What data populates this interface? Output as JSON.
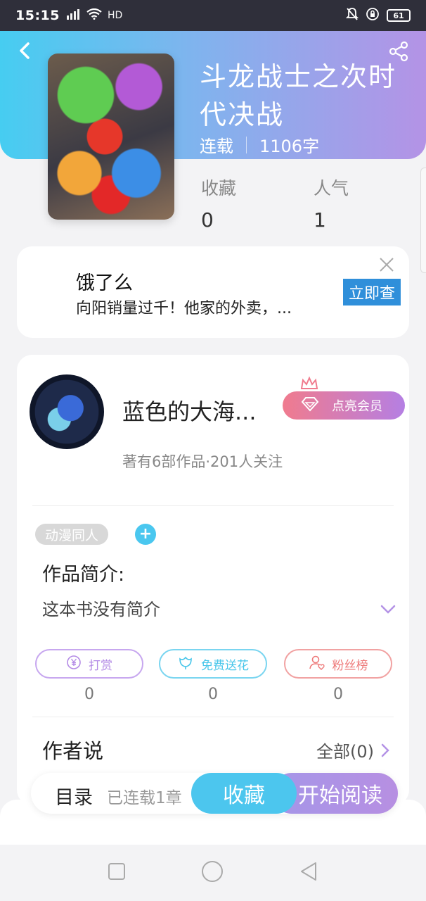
{
  "status_bar": {
    "time": "15:15",
    "signal": "4G",
    "network": "HD",
    "battery": "61"
  },
  "book": {
    "title": "斗龙战士之次时代决战",
    "status": "连载",
    "word_count": "1106字",
    "stats": [
      {
        "label": "收藏",
        "value": "0"
      },
      {
        "label": "人气",
        "value": "1"
      }
    ]
  },
  "ad": {
    "title": "饿了么",
    "description": "向阳销量过千！他家的外卖，...",
    "button": "立即查"
  },
  "author": {
    "name": "蓝色的大海...",
    "vip_button": "点亮会员",
    "info": "著有6部作品·201人关注"
  },
  "tags": {
    "items": [
      "动漫同人"
    ],
    "add_label": "+"
  },
  "intro": {
    "label": "作品简介:",
    "text": "这本书没有简介"
  },
  "actions": [
    {
      "label": "打赏",
      "count": "0",
      "color": "#b48be6"
    },
    {
      "label": "免费送花",
      "count": "0",
      "color": "#48c6ea"
    },
    {
      "label": "粉丝榜",
      "count": "0",
      "color": "#ee7a7a"
    }
  ],
  "author_says": {
    "label": "作者说",
    "link": "全部(0)"
  },
  "bottom_bar": {
    "toc": "目录",
    "chapters": "已连载1章",
    "collect": "收藏",
    "read": "开始阅读"
  },
  "colors": {
    "accent_blue": "#4cc6ee",
    "accent_purple": "#b493e6",
    "vip_pink": "#f07b8e"
  }
}
